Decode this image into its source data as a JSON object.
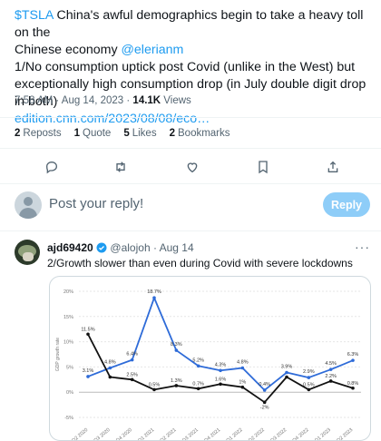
{
  "tweet": {
    "text_line1_cashtag": "$TSLA",
    "text_line1_rest": " China's awful demographics begin to take a heavy toll on the",
    "text_line2": "Chinese economy ",
    "mention": "@elerianm",
    "text_line3": "1/No consumption uptick post Covid (unlike in the West) but",
    "text_line4": "exceptionally high consumption drop (in July double digit drop in both)",
    "link": "edition.cnn.com/2023/08/08/eco…",
    "time": "7:58 AM · Aug 14, 2023 · ",
    "views_count": "14.1K",
    "views_label": " Views"
  },
  "stats": {
    "reposts": {
      "count": "2",
      "label": "Reposts"
    },
    "quotes": {
      "count": "1",
      "label": "Quote"
    },
    "likes": {
      "count": "5",
      "label": "Likes"
    },
    "bookmarks": {
      "count": "2",
      "label": "Bookmarks"
    }
  },
  "actions": [
    "reply-icon",
    "repost-icon",
    "like-icon",
    "bookmark-icon",
    "share-icon"
  ],
  "reply_box": {
    "placeholder": "Post your reply!",
    "button": "Reply"
  },
  "reply": {
    "name": "ajd69420",
    "handle": "@alojoh · Aug 14",
    "more": "···",
    "text": "2/Growth slower than even during Covid with severe lockdowns",
    "verified_color": "#1d9bf0"
  },
  "chart_data": {
    "type": "line",
    "ylabel": "GDP growth rate",
    "y_ticks": [
      "20%",
      "15%",
      "10%",
      "5%",
      "0%",
      "-5%"
    ],
    "ylim": [
      -5,
      20
    ],
    "x_tick_labels": [
      "Q2 2020",
      "Q3 2020",
      "Q4 2020",
      "Q1 2021",
      "Q2 2021",
      "Q3 2021",
      "Q4 2021",
      "Q1 2022",
      "Q2 2022",
      "Q3 2022",
      "Q4 2022",
      "Q1 2023",
      "Q2 2023"
    ],
    "series": [
      {
        "color": "#2e6bd8",
        "values": [
          3.1,
          4.8,
          6.4,
          18.7,
          8.3,
          5.2,
          4.3,
          4.8,
          0.4,
          3.9,
          2.9,
          4.5,
          6.3
        ],
        "labels": [
          "3.1%",
          "4.8%",
          "6.4%",
          "18.7%",
          "8.3%",
          "5.2%",
          "4.3%",
          "4.8%",
          "0.4%",
          "3.9%",
          "2.9%",
          "4.5%",
          "6.3%"
        ]
      },
      {
        "color": "#111111",
        "values": [
          11.5,
          3.0,
          2.5,
          0.5,
          1.3,
          0.7,
          1.6,
          1.0,
          -2.0,
          3.0,
          0.5,
          2.2,
          0.8
        ],
        "labels": [
          "11.5%",
          "",
          "2.5%",
          "0.5%",
          "1.3%",
          "0.7%",
          "1.6%",
          "1%",
          "-2%",
          "",
          "0.5%",
          "2.2%",
          "0.8%"
        ]
      }
    ],
    "grid": true
  }
}
